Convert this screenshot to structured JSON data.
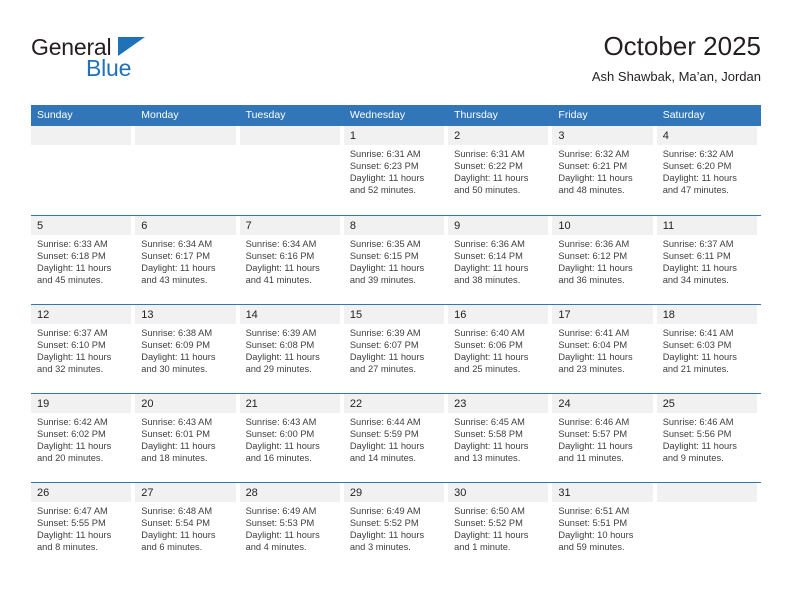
{
  "brand": {
    "name_part1": "General",
    "name_part2": "Blue",
    "triangle_icon": "triangle-icon",
    "color_primary": "#1f71b8",
    "color_text": "#231f20"
  },
  "header": {
    "title": "October 2025",
    "subtitle": "Ash Shawbak, Ma’an, Jordan"
  },
  "calendar": {
    "header_color": "#3176b8",
    "daynum_band_color": "#f1f1f1",
    "weekday_headers": [
      "Sunday",
      "Monday",
      "Tuesday",
      "Wednesday",
      "Thursday",
      "Friday",
      "Saturday"
    ],
    "weeks": [
      [
        {
          "day": "",
          "sunrise": "",
          "sunset": "",
          "daylight_line1": "",
          "daylight_line2": ""
        },
        {
          "day": "",
          "sunrise": "",
          "sunset": "",
          "daylight_line1": "",
          "daylight_line2": ""
        },
        {
          "day": "",
          "sunrise": "",
          "sunset": "",
          "daylight_line1": "",
          "daylight_line2": ""
        },
        {
          "day": "1",
          "sunrise": "Sunrise: 6:31 AM",
          "sunset": "Sunset: 6:23 PM",
          "daylight_line1": "Daylight: 11 hours",
          "daylight_line2": "and 52 minutes."
        },
        {
          "day": "2",
          "sunrise": "Sunrise: 6:31 AM",
          "sunset": "Sunset: 6:22 PM",
          "daylight_line1": "Daylight: 11 hours",
          "daylight_line2": "and 50 minutes."
        },
        {
          "day": "3",
          "sunrise": "Sunrise: 6:32 AM",
          "sunset": "Sunset: 6:21 PM",
          "daylight_line1": "Daylight: 11 hours",
          "daylight_line2": "and 48 minutes."
        },
        {
          "day": "4",
          "sunrise": "Sunrise: 6:32 AM",
          "sunset": "Sunset: 6:20 PM",
          "daylight_line1": "Daylight: 11 hours",
          "daylight_line2": "and 47 minutes."
        }
      ],
      [
        {
          "day": "5",
          "sunrise": "Sunrise: 6:33 AM",
          "sunset": "Sunset: 6:18 PM",
          "daylight_line1": "Daylight: 11 hours",
          "daylight_line2": "and 45 minutes."
        },
        {
          "day": "6",
          "sunrise": "Sunrise: 6:34 AM",
          "sunset": "Sunset: 6:17 PM",
          "daylight_line1": "Daylight: 11 hours",
          "daylight_line2": "and 43 minutes."
        },
        {
          "day": "7",
          "sunrise": "Sunrise: 6:34 AM",
          "sunset": "Sunset: 6:16 PM",
          "daylight_line1": "Daylight: 11 hours",
          "daylight_line2": "and 41 minutes."
        },
        {
          "day": "8",
          "sunrise": "Sunrise: 6:35 AM",
          "sunset": "Sunset: 6:15 PM",
          "daylight_line1": "Daylight: 11 hours",
          "daylight_line2": "and 39 minutes."
        },
        {
          "day": "9",
          "sunrise": "Sunrise: 6:36 AM",
          "sunset": "Sunset: 6:14 PM",
          "daylight_line1": "Daylight: 11 hours",
          "daylight_line2": "and 38 minutes."
        },
        {
          "day": "10",
          "sunrise": "Sunrise: 6:36 AM",
          "sunset": "Sunset: 6:12 PM",
          "daylight_line1": "Daylight: 11 hours",
          "daylight_line2": "and 36 minutes."
        },
        {
          "day": "11",
          "sunrise": "Sunrise: 6:37 AM",
          "sunset": "Sunset: 6:11 PM",
          "daylight_line1": "Daylight: 11 hours",
          "daylight_line2": "and 34 minutes."
        }
      ],
      [
        {
          "day": "12",
          "sunrise": "Sunrise: 6:37 AM",
          "sunset": "Sunset: 6:10 PM",
          "daylight_line1": "Daylight: 11 hours",
          "daylight_line2": "and 32 minutes."
        },
        {
          "day": "13",
          "sunrise": "Sunrise: 6:38 AM",
          "sunset": "Sunset: 6:09 PM",
          "daylight_line1": "Daylight: 11 hours",
          "daylight_line2": "and 30 minutes."
        },
        {
          "day": "14",
          "sunrise": "Sunrise: 6:39 AM",
          "sunset": "Sunset: 6:08 PM",
          "daylight_line1": "Daylight: 11 hours",
          "daylight_line2": "and 29 minutes."
        },
        {
          "day": "15",
          "sunrise": "Sunrise: 6:39 AM",
          "sunset": "Sunset: 6:07 PM",
          "daylight_line1": "Daylight: 11 hours",
          "daylight_line2": "and 27 minutes."
        },
        {
          "day": "16",
          "sunrise": "Sunrise: 6:40 AM",
          "sunset": "Sunset: 6:06 PM",
          "daylight_line1": "Daylight: 11 hours",
          "daylight_line2": "and 25 minutes."
        },
        {
          "day": "17",
          "sunrise": "Sunrise: 6:41 AM",
          "sunset": "Sunset: 6:04 PM",
          "daylight_line1": "Daylight: 11 hours",
          "daylight_line2": "and 23 minutes."
        },
        {
          "day": "18",
          "sunrise": "Sunrise: 6:41 AM",
          "sunset": "Sunset: 6:03 PM",
          "daylight_line1": "Daylight: 11 hours",
          "daylight_line2": "and 21 minutes."
        }
      ],
      [
        {
          "day": "19",
          "sunrise": "Sunrise: 6:42 AM",
          "sunset": "Sunset: 6:02 PM",
          "daylight_line1": "Daylight: 11 hours",
          "daylight_line2": "and 20 minutes."
        },
        {
          "day": "20",
          "sunrise": "Sunrise: 6:43 AM",
          "sunset": "Sunset: 6:01 PM",
          "daylight_line1": "Daylight: 11 hours",
          "daylight_line2": "and 18 minutes."
        },
        {
          "day": "21",
          "sunrise": "Sunrise: 6:43 AM",
          "sunset": "Sunset: 6:00 PM",
          "daylight_line1": "Daylight: 11 hours",
          "daylight_line2": "and 16 minutes."
        },
        {
          "day": "22",
          "sunrise": "Sunrise: 6:44 AM",
          "sunset": "Sunset: 5:59 PM",
          "daylight_line1": "Daylight: 11 hours",
          "daylight_line2": "and 14 minutes."
        },
        {
          "day": "23",
          "sunrise": "Sunrise: 6:45 AM",
          "sunset": "Sunset: 5:58 PM",
          "daylight_line1": "Daylight: 11 hours",
          "daylight_line2": "and 13 minutes."
        },
        {
          "day": "24",
          "sunrise": "Sunrise: 6:46 AM",
          "sunset": "Sunset: 5:57 PM",
          "daylight_line1": "Daylight: 11 hours",
          "daylight_line2": "and 11 minutes."
        },
        {
          "day": "25",
          "sunrise": "Sunrise: 6:46 AM",
          "sunset": "Sunset: 5:56 PM",
          "daylight_line1": "Daylight: 11 hours",
          "daylight_line2": "and 9 minutes."
        }
      ],
      [
        {
          "day": "26",
          "sunrise": "Sunrise: 6:47 AM",
          "sunset": "Sunset: 5:55 PM",
          "daylight_line1": "Daylight: 11 hours",
          "daylight_line2": "and 8 minutes."
        },
        {
          "day": "27",
          "sunrise": "Sunrise: 6:48 AM",
          "sunset": "Sunset: 5:54 PM",
          "daylight_line1": "Daylight: 11 hours",
          "daylight_line2": "and 6 minutes."
        },
        {
          "day": "28",
          "sunrise": "Sunrise: 6:49 AM",
          "sunset": "Sunset: 5:53 PM",
          "daylight_line1": "Daylight: 11 hours",
          "daylight_line2": "and 4 minutes."
        },
        {
          "day": "29",
          "sunrise": "Sunrise: 6:49 AM",
          "sunset": "Sunset: 5:52 PM",
          "daylight_line1": "Daylight: 11 hours",
          "daylight_line2": "and 3 minutes."
        },
        {
          "day": "30",
          "sunrise": "Sunrise: 6:50 AM",
          "sunset": "Sunset: 5:52 PM",
          "daylight_line1": "Daylight: 11 hours",
          "daylight_line2": "and 1 minute."
        },
        {
          "day": "31",
          "sunrise": "Sunrise: 6:51 AM",
          "sunset": "Sunset: 5:51 PM",
          "daylight_line1": "Daylight: 10 hours",
          "daylight_line2": "and 59 minutes."
        },
        {
          "day": "",
          "sunrise": "",
          "sunset": "",
          "daylight_line1": "",
          "daylight_line2": ""
        }
      ]
    ]
  }
}
